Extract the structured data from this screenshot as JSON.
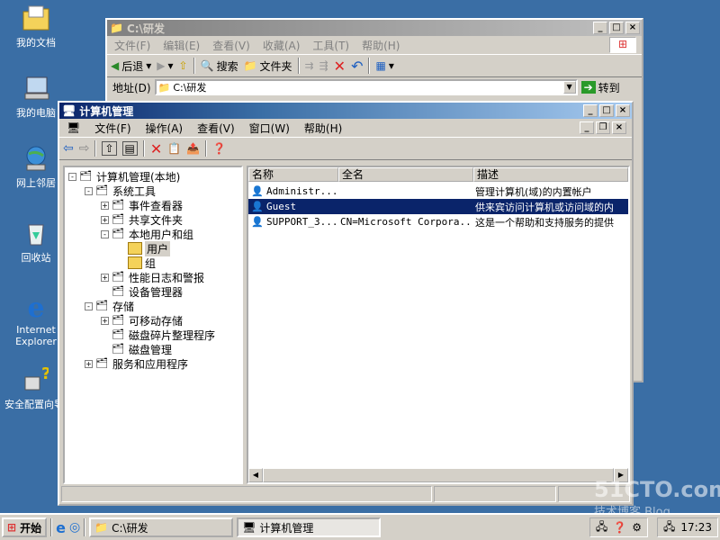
{
  "desktop": {
    "icons": [
      {
        "label": "我的文档",
        "icon": "folder-docs-icon"
      },
      {
        "label": "我的电脑",
        "icon": "computer-icon"
      },
      {
        "label": "网上邻居",
        "icon": "network-icon"
      },
      {
        "label": "回收站",
        "icon": "recycle-bin-icon"
      },
      {
        "label": "Internet Explorer",
        "icon": "ie-icon"
      },
      {
        "label": "安全配置向导",
        "icon": "security-wizard-icon"
      }
    ]
  },
  "explorer": {
    "title": "C:\\研发",
    "menu": [
      "文件(F)",
      "编辑(E)",
      "查看(V)",
      "收藏(A)",
      "工具(T)",
      "帮助(H)"
    ],
    "toolbar": {
      "back": "后退",
      "search": "搜索",
      "folders": "文件夹"
    },
    "address_label": "地址(D)",
    "address_value": "C:\\研发",
    "go_label": "转到"
  },
  "mmc": {
    "title": "计算机管理",
    "menu": [
      "文件(F)",
      "操作(A)",
      "查看(V)",
      "窗口(W)",
      "帮助(H)"
    ],
    "tree": [
      {
        "label": "计算机管理(本地)",
        "level": 0,
        "expander": "-"
      },
      {
        "label": "系统工具",
        "level": 1,
        "expander": "-"
      },
      {
        "label": "事件查看器",
        "level": 2,
        "expander": "+"
      },
      {
        "label": "共享文件夹",
        "level": 2,
        "expander": "+"
      },
      {
        "label": "本地用户和组",
        "level": 2,
        "expander": "-"
      },
      {
        "label": "用户",
        "level": 3,
        "expander": "",
        "selected": true
      },
      {
        "label": "组",
        "level": 3,
        "expander": ""
      },
      {
        "label": "性能日志和警报",
        "level": 2,
        "expander": "+"
      },
      {
        "label": "设备管理器",
        "level": 2,
        "expander": ""
      },
      {
        "label": "存储",
        "level": 1,
        "expander": "-"
      },
      {
        "label": "可移动存储",
        "level": 2,
        "expander": "+"
      },
      {
        "label": "磁盘碎片整理程序",
        "level": 2,
        "expander": ""
      },
      {
        "label": "磁盘管理",
        "level": 2,
        "expander": ""
      },
      {
        "label": "服务和应用程序",
        "level": 1,
        "expander": "+"
      }
    ],
    "columns": [
      "名称",
      "全名",
      "描述"
    ],
    "rows": [
      {
        "name": "Administr...",
        "fullname": "",
        "desc": "管理计算机(域)的内置帐户",
        "selected": false
      },
      {
        "name": "Guest",
        "fullname": "",
        "desc": "供来宾访问计算机或访问域的内",
        "selected": true
      },
      {
        "name": "SUPPORT_3...",
        "fullname": "CN=Microsoft Corpora...",
        "desc": "这是一个帮助和支持服务的提供",
        "selected": false
      }
    ]
  },
  "taskbar": {
    "start": "开始",
    "tasks": [
      "C:\\研发",
      "计算机管理"
    ],
    "clock": "17:23"
  },
  "watermark": {
    "line1": "51CTO.com",
    "line2": "技术博客  Blog"
  },
  "colors": {
    "desktop": "#3a6ea5",
    "selection": "#0a246a",
    "window": "#d4d0c8"
  }
}
